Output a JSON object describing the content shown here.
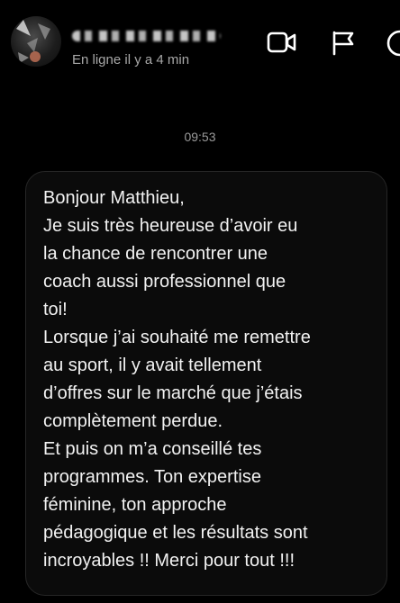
{
  "header": {
    "contact_name": "",
    "status": "En ligne il y a 4 min",
    "icons": [
      "video-call-icon",
      "report-flag-icon",
      "info-icon"
    ]
  },
  "conversation": {
    "timestamp": "09:53",
    "message_lines": [
      "Bonjour Matthieu,",
      "Je suis très heureuse d’avoir eu",
      "la chance de rencontrer une",
      "coach aussi professionnel que",
      "toi!",
      "Lorsque j’ai souhaité me remettre",
      "au sport, il y avait tellement",
      "d’offres sur le marché que j’étais",
      "complètement perdue.",
      "Et puis on m’a conseillé tes",
      "programmes. Ton expertise",
      "féminine, ton approche",
      "pédagogique et les résultats sont",
      "incroyables !! Merci pour tout !!!"
    ]
  },
  "colors": {
    "background": "#000000",
    "bubble": "#0b0b0b",
    "bubble_border": "#262626",
    "text": "#f2f2f2",
    "secondary_text": "#a8a8a8"
  }
}
